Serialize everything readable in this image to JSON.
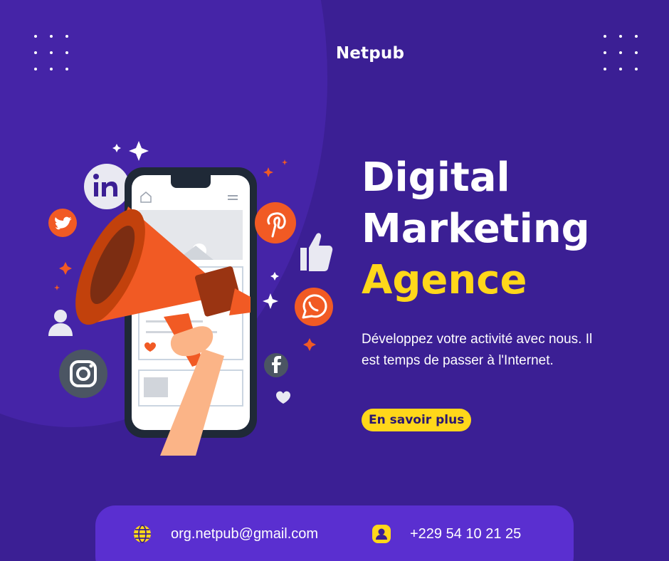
{
  "brand": "Netpub",
  "headline": {
    "line1": "Digital",
    "line2": "Marketing",
    "line3": "Agence"
  },
  "description": "Développez votre activité avec nous. Il est temps de passer à l'Internet.",
  "cta_label": "En savoir plus",
  "contact": {
    "email": "org.netpub@gmail.com",
    "phone": "+229 54 10 21 25"
  },
  "colors": {
    "background": "#3b1f94",
    "accent_yellow": "#ffd71a",
    "accent_orange": "#f15a24",
    "footer": "#5a2fd0"
  },
  "icons": [
    "linkedin-icon",
    "twitter-icon",
    "pinterest-icon",
    "thumbs-up-icon",
    "whatsapp-icon",
    "user-icon",
    "instagram-icon",
    "facebook-icon",
    "heart-icon",
    "globe-icon",
    "contact-icon",
    "megaphone-icon"
  ]
}
